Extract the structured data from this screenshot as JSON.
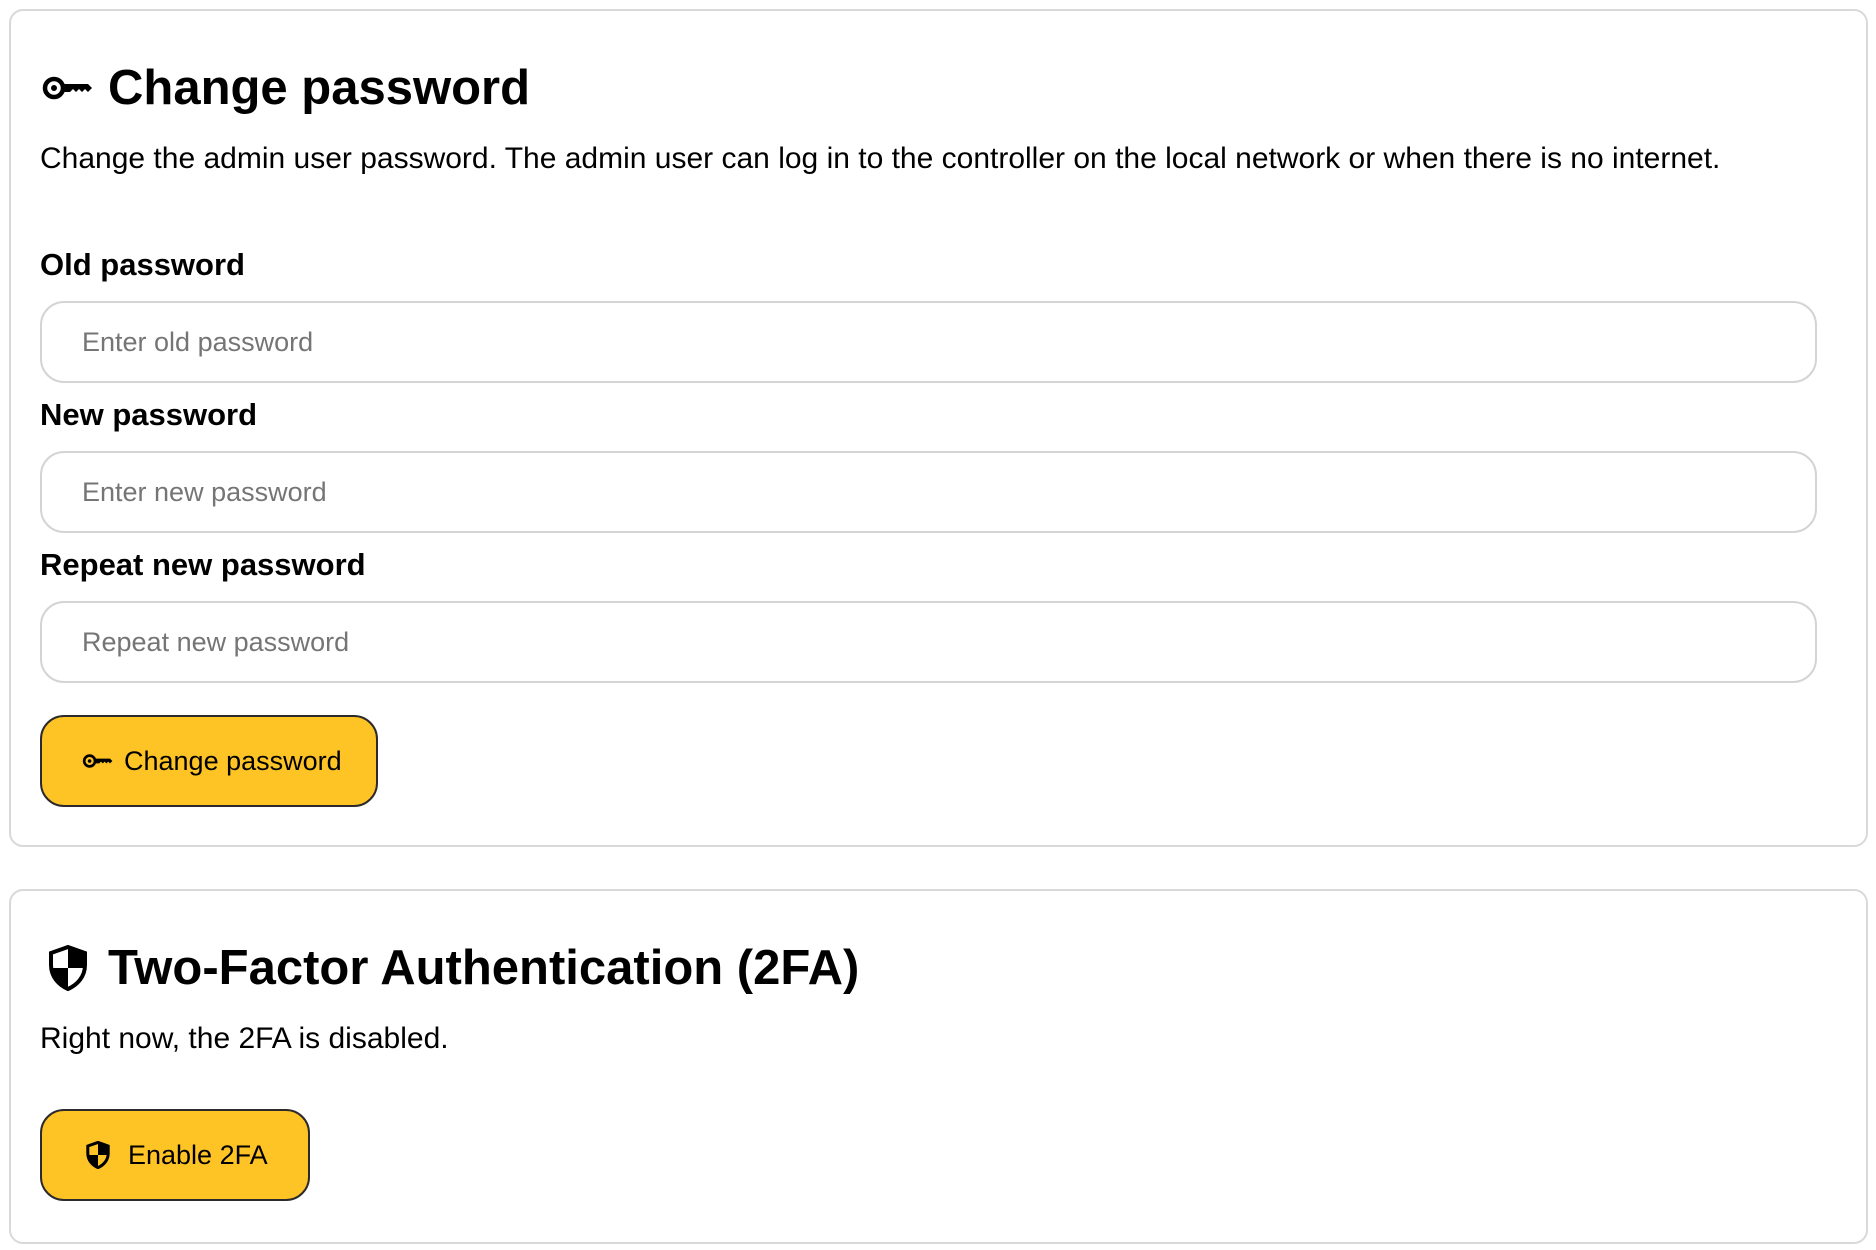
{
  "password_section": {
    "title": "Change password",
    "title_icon": "key-icon",
    "description": "Change the admin user password. The admin user can log in to the controller on the local network or when there is no internet.",
    "fields": [
      {
        "label": "Old password",
        "placeholder": "Enter old password",
        "value": ""
      },
      {
        "label": "New password",
        "placeholder": "Enter new password",
        "value": ""
      },
      {
        "label": "Repeat new password",
        "placeholder": "Repeat new password",
        "value": ""
      }
    ],
    "submit_button": {
      "label": "Change password",
      "icon": "key-icon"
    }
  },
  "twofa_section": {
    "title": "Two-Factor Authentication (2FA)",
    "title_icon": "shield-icon",
    "status_text": "Right now, the 2FA is disabled.",
    "enable_button": {
      "label": "Enable 2FA",
      "icon": "shield-icon"
    }
  },
  "colors": {
    "button_bg": "#fec325",
    "button_border": "#2b2b2b",
    "card_border": "#d9d9d9",
    "input_border": "#d4d4d4",
    "placeholder": "#757575"
  }
}
